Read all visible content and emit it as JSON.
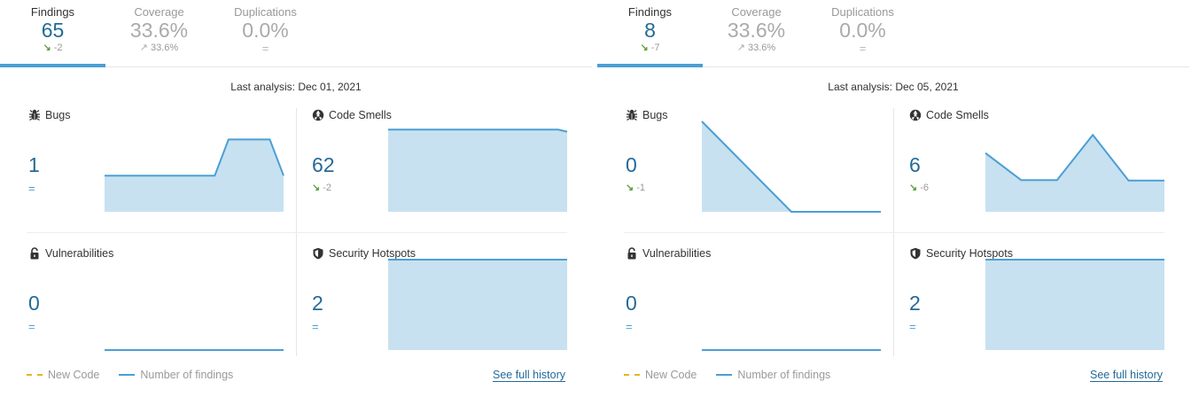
{
  "accent": "#236a97",
  "panels": [
    {
      "tabs": [
        {
          "label": "Findings",
          "value": "65",
          "delta": "-2",
          "delta_icon": "arrow-down-right-icon",
          "active": true
        },
        {
          "label": "Coverage",
          "value": "33.6%",
          "delta": "33.6%",
          "delta_icon": "arrow-up-right-icon",
          "active": false
        },
        {
          "label": "Duplications",
          "value": "0.0%",
          "delta": "=",
          "delta_icon": "",
          "active": false
        }
      ],
      "last_analysis": "Last analysis: Dec 01, 2021",
      "cards": [
        {
          "title": "Bugs",
          "icon": "bug-icon",
          "value": "1",
          "delta": "=",
          "series": [
            1,
            1,
            1,
            1,
            1,
            1,
            1,
            1,
            1,
            2,
            2,
            2,
            2,
            1
          ]
        },
        {
          "title": "Code Smells",
          "icon": "code-smell-icon",
          "value": "62",
          "delta": "-2",
          "series": [
            64,
            64,
            64,
            64,
            64,
            64,
            64,
            64,
            64,
            64,
            64,
            64,
            64,
            64,
            64,
            64,
            64,
            64,
            64,
            64,
            63.5
          ]
        },
        {
          "title": "Vulnerabilities",
          "icon": "lock-icon",
          "value": "0",
          "delta": "=",
          "series": [
            0,
            0
          ]
        },
        {
          "title": "Security Hotspots",
          "icon": "shield-icon",
          "value": "2",
          "delta": "=",
          "series": [
            2,
            2
          ]
        }
      ],
      "legend": {
        "new_code": "New Code",
        "findings": "Number of findings"
      },
      "history_link": "See full history"
    },
    {
      "tabs": [
        {
          "label": "Findings",
          "value": "8",
          "delta": "-7",
          "delta_icon": "arrow-down-right-icon",
          "active": true
        },
        {
          "label": "Coverage",
          "value": "33.6%",
          "delta": "33.6%",
          "delta_icon": "arrow-up-right-icon",
          "active": false
        },
        {
          "label": "Duplications",
          "value": "0.0%",
          "delta": "=",
          "delta_icon": "",
          "active": false
        }
      ],
      "last_analysis": "Last analysis: Dec 05, 2021",
      "cards": [
        {
          "title": "Bugs",
          "icon": "bug-icon",
          "value": "0",
          "delta": "-1",
          "series": [
            1,
            0,
            0
          ]
        },
        {
          "title": "Code Smells",
          "icon": "code-smell-icon",
          "value": "6",
          "delta": "-6",
          "series": [
            13,
            7,
            7,
            17,
            6.9,
            6.9
          ]
        },
        {
          "title": "Vulnerabilities",
          "icon": "lock-icon",
          "value": "0",
          "delta": "=",
          "series": [
            0,
            0
          ]
        },
        {
          "title": "Security Hotspots",
          "icon": "shield-icon",
          "value": "2",
          "delta": "=",
          "series": [
            2,
            2
          ]
        }
      ],
      "legend": {
        "new_code": "New Code",
        "findings": "Number of findings"
      },
      "history_link": "See full history"
    }
  ]
}
